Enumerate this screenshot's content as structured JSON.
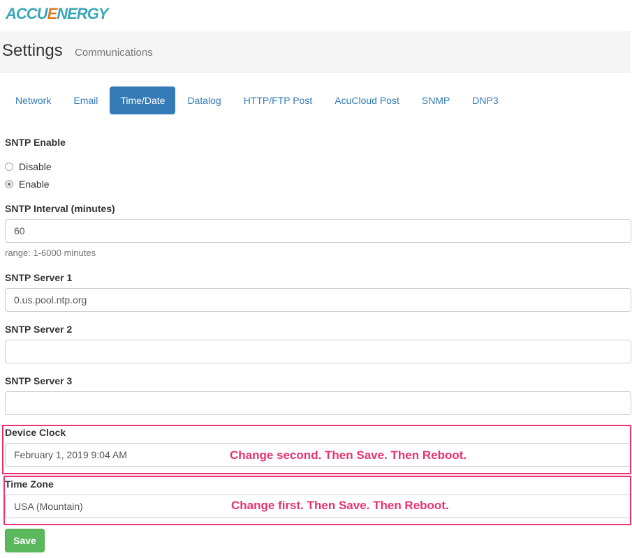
{
  "brand": {
    "logo_prefix": "ACCU",
    "logo_mark": "E",
    "logo_suffix": "NERGY"
  },
  "header": {
    "title": "Settings",
    "subtitle": "Communications"
  },
  "tabs": [
    {
      "label": "Network",
      "active": false
    },
    {
      "label": "Email",
      "active": false
    },
    {
      "label": "Time/Date",
      "active": true
    },
    {
      "label": "Datalog",
      "active": false
    },
    {
      "label": "HTTP/FTP Post",
      "active": false
    },
    {
      "label": "AcuCloud Post",
      "active": false
    },
    {
      "label": "SNMP",
      "active": false
    },
    {
      "label": "DNP3",
      "active": false
    }
  ],
  "sntp_enable": {
    "label": "SNTP Enable",
    "options": [
      {
        "label": "Disable",
        "checked": false
      },
      {
        "label": "Enable",
        "checked": true
      }
    ]
  },
  "sntp_interval": {
    "label": "SNTP Interval (minutes)",
    "value": "60",
    "help": "range: 1-6000 minutes"
  },
  "sntp_server_1": {
    "label": "SNTP Server 1",
    "value": "0.us.pool.ntp.org"
  },
  "sntp_server_2": {
    "label": "SNTP Server 2",
    "value": ""
  },
  "sntp_server_3": {
    "label": "SNTP Server 3",
    "value": ""
  },
  "device_clock": {
    "label": "Device Clock",
    "value": "February 1, 2019 9:04 AM",
    "annotation": "Change second.  Then Save.  Then Reboot."
  },
  "time_zone": {
    "label": "Time Zone",
    "value": "USA (Mountain)",
    "annotation": "Change first.  Then Save.  Then Reboot."
  },
  "save_button": {
    "label": "Save"
  },
  "colors": {
    "primary": "#337ab7",
    "success": "#5cb85c",
    "highlight": "#e8336e",
    "logo_teal": "#3aa6b9",
    "logo_orange": "#e0781e"
  },
  "icons": {
    "radio": "radio-button"
  }
}
